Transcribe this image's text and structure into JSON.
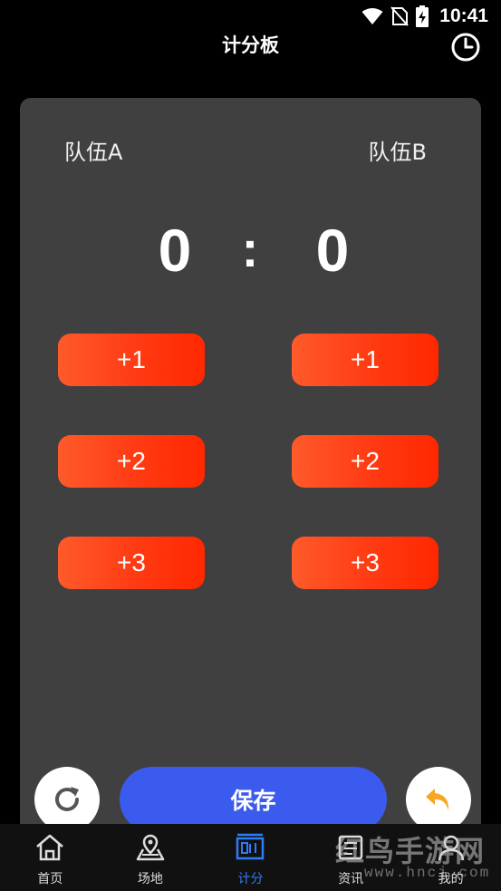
{
  "status_bar": {
    "time": "10:41"
  },
  "header": {
    "title": "计分板"
  },
  "teams": {
    "a_name": "队伍A",
    "b_name": "队伍B"
  },
  "scores": {
    "a": "0",
    "separator": ":",
    "b": "0"
  },
  "buttons": {
    "plus1": "+1",
    "plus2": "+2",
    "plus3": "+3",
    "save": "保存"
  },
  "tabs": [
    {
      "label": "首页",
      "icon": "home-icon"
    },
    {
      "label": "场地",
      "icon": "map-icon"
    },
    {
      "label": "计分",
      "icon": "scoreboard-icon",
      "active": true
    },
    {
      "label": "资讯",
      "icon": "news-icon"
    },
    {
      "label": "我的",
      "icon": "profile-icon"
    }
  ],
  "watermark": {
    "main": "红鸟手游网",
    "sub": "www.hncj.com"
  },
  "colors": {
    "background": "#000000",
    "card": "#404040",
    "point_button": "#ff3a12",
    "save_button": "#3b5bef",
    "active_tab": "#2e7cf6",
    "undo_icon": "#f5a623"
  }
}
